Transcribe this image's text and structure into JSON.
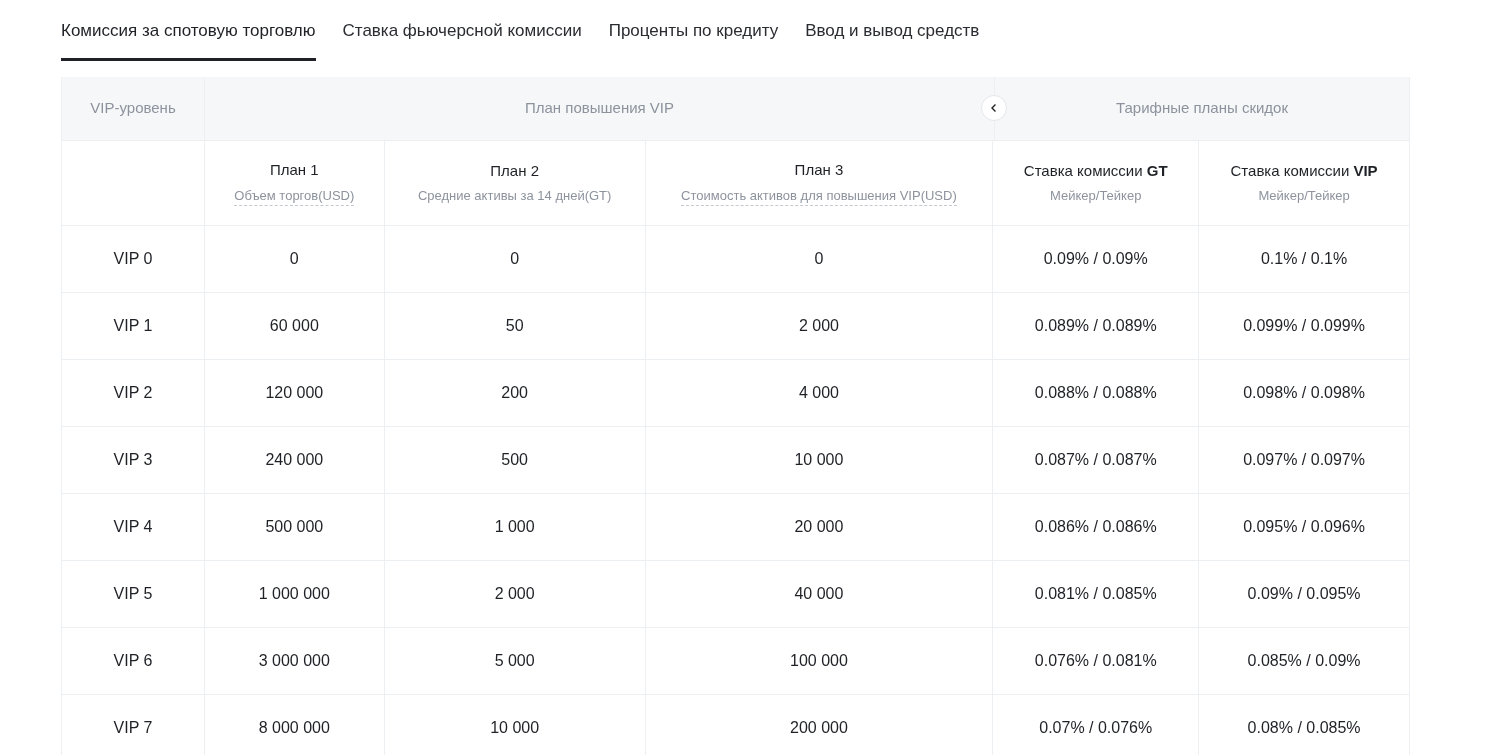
{
  "tabs": [
    {
      "label": "Комиссия за спотовую торговлю",
      "selected": true
    },
    {
      "label": "Ставка фьючерсной комиссии",
      "selected": false
    },
    {
      "label": "Проценты по кредиту",
      "selected": false
    },
    {
      "label": "Ввод и вывод средств",
      "selected": false
    }
  ],
  "table": {
    "group_headers": {
      "level": "VIP-уровень",
      "upgrade": "План повышения VIP",
      "discount": "Тарифные планы скидок"
    },
    "columns": [
      {},
      {
        "title": "План 1",
        "subtitle": "Объем торгов(USD)",
        "dashed": true
      },
      {
        "title": "План 2",
        "subtitle": "Средние активы за 14 дней(GT)",
        "dashed": false
      },
      {
        "title": "План 3",
        "subtitle": "Стоимость активов для повышения VIP(USD)",
        "dashed": true
      },
      {
        "title": "Ставка комиссии **GT**",
        "subtitle": "Мейкер/Тейкер",
        "dashed": false
      },
      {
        "title": "Ставка комиссии **VIP**",
        "subtitle": "Мейкер/Тейкер",
        "dashed": false
      }
    ],
    "rows": [
      [
        "VIP 0",
        "0",
        "0",
        "0",
        "0.09% / 0.09%",
        "0.1% / 0.1%"
      ],
      [
        "VIP 1",
        "60 000",
        "50",
        "2 000",
        "0.089% / 0.089%",
        "0.099% / 0.099%"
      ],
      [
        "VIP 2",
        "120 000",
        "200",
        "4 000",
        "0.088% / 0.088%",
        "0.098% / 0.098%"
      ],
      [
        "VIP 3",
        "240 000",
        "500",
        "10 000",
        "0.087% / 0.087%",
        "0.097% / 0.097%"
      ],
      [
        "VIP 4",
        "500 000",
        "1 000",
        "20 000",
        "0.086% / 0.086%",
        "0.095% / 0.096%"
      ],
      [
        "VIP 5",
        "1 000 000",
        "2 000",
        "40 000",
        "0.081% / 0.085%",
        "0.09% / 0.095%"
      ],
      [
        "VIP 6",
        "3 000 000",
        "5 000",
        "100 000",
        "0.076% / 0.081%",
        "0.085% / 0.09%"
      ],
      [
        "VIP 7",
        "8 000 000",
        "10 000",
        "200 000",
        "0.07% / 0.076%",
        "0.08% / 0.085%"
      ]
    ]
  }
}
